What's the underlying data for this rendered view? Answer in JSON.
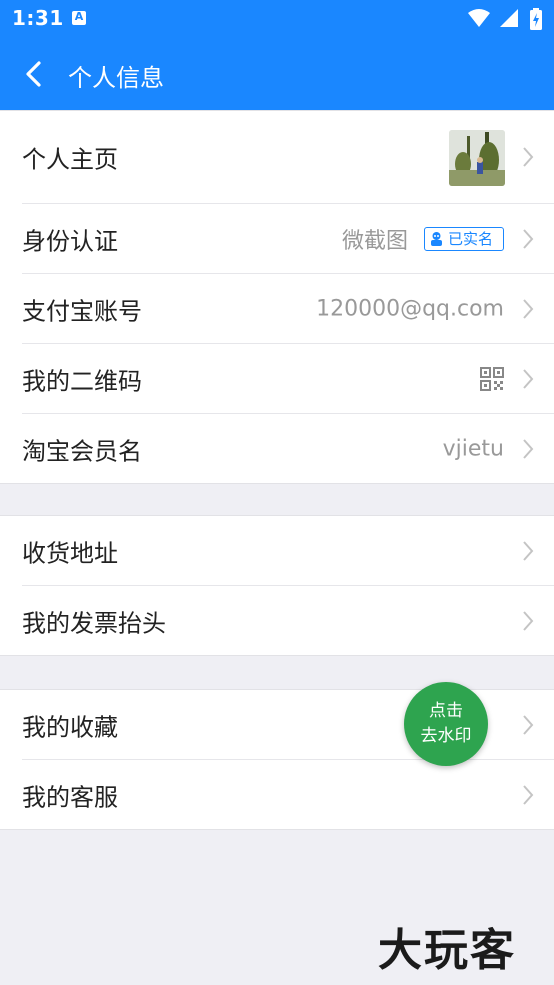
{
  "status_bar": {
    "time": "1:31",
    "notification_icon": "a-letter-icon",
    "icons": [
      "wifi-icon",
      "signal-icon",
      "battery-charging-icon"
    ]
  },
  "app_bar": {
    "title": "个人信息",
    "back_icon": "back-arrow-icon",
    "color": "#1a87ff"
  },
  "groups": [
    {
      "rows": [
        {
          "label": "个人主页",
          "value_type": "avatar"
        },
        {
          "label": "身份认证",
          "value": "微截图",
          "badge": "已实名"
        },
        {
          "label": "支付宝账号",
          "value": "120000@qq.com"
        },
        {
          "label": "我的二维码",
          "value_type": "qr-icon"
        },
        {
          "label": "淘宝会员名",
          "value": "vjietu"
        }
      ]
    },
    {
      "rows": [
        {
          "label": "收货地址"
        },
        {
          "label": "我的发票抬头"
        }
      ]
    },
    {
      "rows": [
        {
          "label": "我的收藏"
        },
        {
          "label": "我的客服"
        }
      ]
    }
  ],
  "fab": {
    "line1": "点击",
    "line2": "去水印",
    "color": "#2ea44f"
  },
  "brand_logo": "大玩客"
}
